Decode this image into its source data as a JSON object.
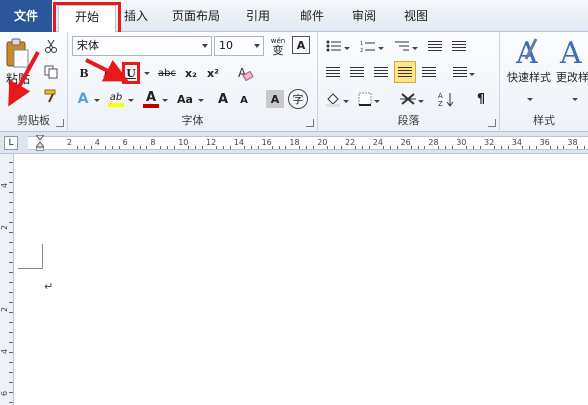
{
  "tabs": {
    "file": "文件",
    "home": "开始",
    "insert": "插入",
    "page_layout": "页面布局",
    "references": "引用",
    "mailings": "邮件",
    "review": "审阅",
    "view": "视图"
  },
  "clipboard": {
    "paste": "粘贴",
    "group_label": "剪贴板"
  },
  "font": {
    "name": "宋体",
    "size": "10",
    "group_label": "字体",
    "bold": "B",
    "italic": "I",
    "underline": "U",
    "strike": "abc",
    "subscript": "x₂",
    "superscript": "x²",
    "grow": "A",
    "shrink": "A",
    "change_case": "Aa",
    "char_shading": "A",
    "enclose": "字",
    "wen": "wén",
    "wen_char": "变",
    "clear_format": "A",
    "highlight": "ab",
    "font_color": "A"
  },
  "paragraph": {
    "group_label": "段落"
  },
  "styles": {
    "quick_styles": "快速样式",
    "change_styles": "更改样",
    "group_label": "样式"
  },
  "ruler": {
    "tab_selector": "L",
    "numbers": [
      "2",
      "4",
      "6",
      "8",
      "10",
      "12",
      "14",
      "16",
      "18",
      "20",
      "22",
      "24",
      "26",
      "28",
      "30",
      "32",
      "34",
      "36",
      "38"
    ]
  },
  "vruler": {
    "numbers": [
      "4",
      "2",
      "2",
      "4",
      "6"
    ]
  },
  "document": {
    "paragraph_mark": "↵"
  },
  "colors": {
    "accent": "#2b579a",
    "annotation": "#e8191b"
  }
}
